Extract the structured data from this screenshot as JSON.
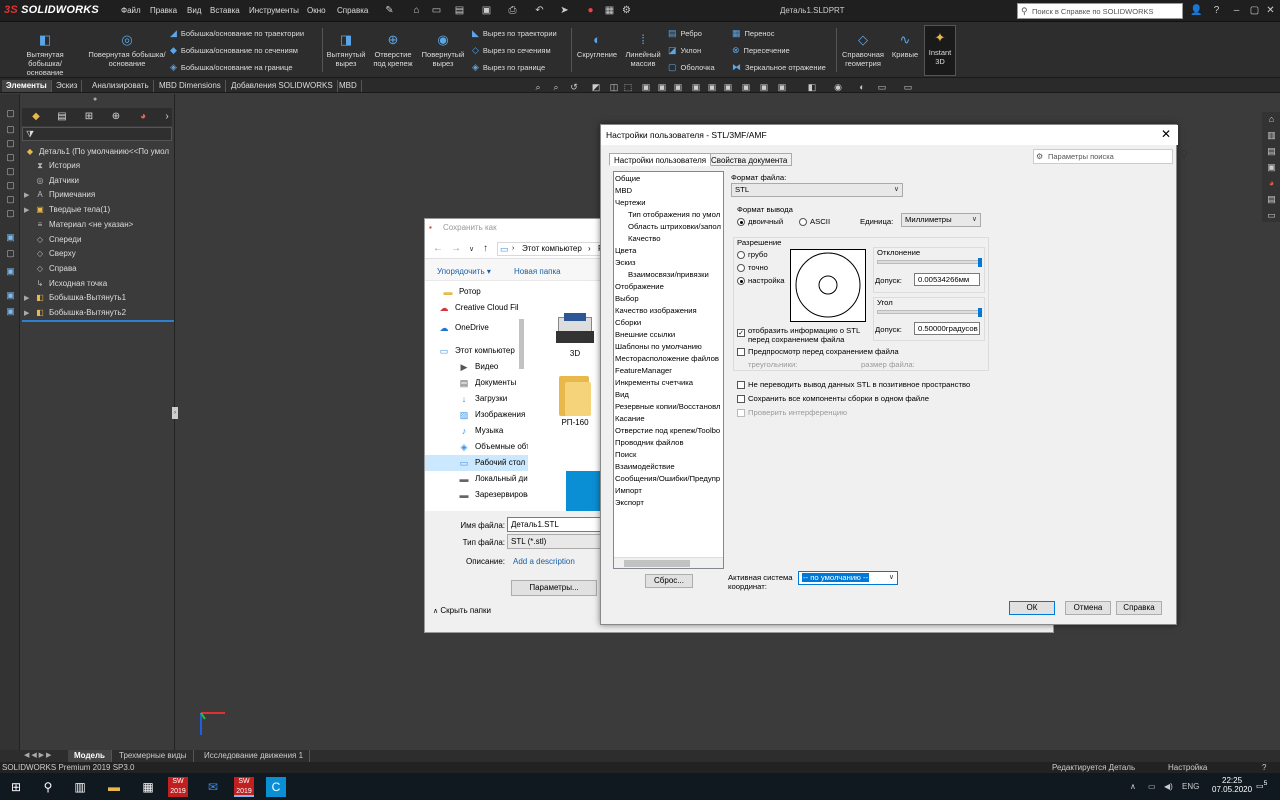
{
  "app": {
    "logo_ds": "3S",
    "logo_text": "SOLIDWORKS",
    "menu": [
      "Файл",
      "Правка",
      "Вид",
      "Вставка",
      "Инструменты",
      "Окно",
      "Справка"
    ],
    "doc_title": "Деталь1.SLDPRT",
    "search_placeholder": "Поиск в Справке по SOLIDWORKS"
  },
  "ribbon": {
    "big": [
      {
        "label": "Вытянутая бобышка/основание",
        "icon": "extrude-boss-icon"
      },
      {
        "label": "Повернутая бобышка/основание",
        "icon": "revolve-boss-icon"
      }
    ],
    "boss_rows": [
      "Бобышка/основание по траектории",
      "Бобышка/основание по сечениям",
      "Бобышка/основание на границе"
    ],
    "cut_big": [
      {
        "label": "Вытянутый вырез",
        "icon": "extrude-cut-icon"
      },
      {
        "label": "Отверстие под крепеж",
        "icon": "hole-wizard-icon"
      },
      {
        "label": "Повернутый вырез",
        "icon": "revolve-cut-icon"
      }
    ],
    "cut_rows": [
      "Вырез по траектории",
      "Вырез по сечениям",
      "Вырез по границе"
    ],
    "feat_big": [
      {
        "label": "Скругление",
        "icon": "fillet-icon"
      },
      {
        "label": "Линейный массив",
        "icon": "linear-pattern-icon"
      }
    ],
    "feat_rows": [
      "Ребро",
      "Уклон",
      "Оболочка"
    ],
    "feat_rows2": [
      "Перенос",
      "Пересечение",
      "Зеркальное отражение"
    ],
    "ref_big": [
      {
        "label": "Справочная геометрия",
        "icon": "ref-geometry-icon"
      },
      {
        "label": "Кривые",
        "icon": "curves-icon"
      },
      {
        "label": "Instant 3D",
        "icon": "instant3d-icon"
      }
    ]
  },
  "tabs": [
    "Элементы",
    "Эскиз",
    "Анализировать",
    "MBD Dimensions",
    "Добавления SOLIDWORKS",
    "MBD"
  ],
  "tree": {
    "root": "Деталь1  (По умолчанию<<По умол",
    "items": [
      {
        "label": "История",
        "icon": "history-icon",
        "expand": ""
      },
      {
        "label": "Датчики",
        "icon": "sensor-icon",
        "expand": ""
      },
      {
        "label": "Примечания",
        "icon": "annotations-icon",
        "expand": "▶"
      },
      {
        "label": "Твердые тела(1)",
        "icon": "solid-bodies-icon",
        "expand": "▶"
      },
      {
        "label": "Материал <не указан>",
        "icon": "material-icon",
        "expand": ""
      },
      {
        "label": "Спереди",
        "icon": "plane-icon",
        "expand": ""
      },
      {
        "label": "Сверху",
        "icon": "plane-icon",
        "expand": ""
      },
      {
        "label": "Справа",
        "icon": "plane-icon",
        "expand": ""
      },
      {
        "label": "Исходная точка",
        "icon": "origin-icon",
        "expand": ""
      },
      {
        "label": "Бобышка-Вытянуть1",
        "icon": "extrude-icon",
        "expand": "▶"
      },
      {
        "label": "Бобышка-Вытянуть2",
        "icon": "extrude-icon",
        "expand": "▶"
      }
    ]
  },
  "save_dialog": {
    "title": "Сохранить как",
    "address": "Этот компьютер",
    "address_suffix": "Р",
    "organize": "Упорядочить ▾",
    "new_folder": "Новая папка",
    "side": [
      {
        "label": "Ротор",
        "icon": "folder-icon"
      },
      {
        "label": "Creative Cloud Fil",
        "icon": "cloud-icon"
      },
      {
        "label": "OneDrive",
        "icon": "onedrive-icon"
      },
      {
        "label": "Этот компьютер",
        "icon": "computer-icon"
      },
      {
        "label": "Видео",
        "icon": "video-icon"
      },
      {
        "label": "Документы",
        "icon": "documents-icon"
      },
      {
        "label": "Загрузки",
        "icon": "downloads-icon"
      },
      {
        "label": "Изображения",
        "icon": "images-icon"
      },
      {
        "label": "Музыка",
        "icon": "music-icon"
      },
      {
        "label": "Объемные объе",
        "icon": "3d-objects-icon"
      },
      {
        "label": "Рабочий стол",
        "icon": "desktop-icon"
      },
      {
        "label": "Локальный дис",
        "icon": "disk-icon"
      },
      {
        "label": "Зарезервирован",
        "icon": "disk-icon"
      }
    ],
    "files": [
      {
        "label": "3D",
        "icon": "printer-icon"
      },
      {
        "label": "РП-160",
        "icon": "folder-icon"
      }
    ],
    "filename_label": "Имя файла:",
    "filename": "Деталь1.STL",
    "filetype_label": "Тип файла:",
    "filetype": "STL (*.stl)",
    "desc_label": "Описание:",
    "desc_link": "Add a description",
    "params_btn": "Параметры...",
    "hide_folders": "Скрыть папки"
  },
  "settings": {
    "title": "Настройки пользователя - STL/3MF/AMF",
    "tab_user": "Настройки пользователя",
    "tab_doc": "Свойства документа",
    "search": "Параметры поиска",
    "list": [
      {
        "label": "Общие",
        "sub": false
      },
      {
        "label": "MBD",
        "sub": false
      },
      {
        "label": "Чертежи",
        "sub": false
      },
      {
        "label": "Тип отображения по умол",
        "sub": true
      },
      {
        "label": "Область штриховки/запол",
        "sub": true
      },
      {
        "label": "Качество",
        "sub": true
      },
      {
        "label": "Цвета",
        "sub": false
      },
      {
        "label": "Эскиз",
        "sub": false
      },
      {
        "label": "Взаимосвязи/привязки",
        "sub": true
      },
      {
        "label": "Отображение",
        "sub": false
      },
      {
        "label": "Выбор",
        "sub": false
      },
      {
        "label": "Качество изображения",
        "sub": false
      },
      {
        "label": "Сборки",
        "sub": false
      },
      {
        "label": "Внешние ссылки",
        "sub": false
      },
      {
        "label": "Шаблоны по умолчанию",
        "sub": false
      },
      {
        "label": "Месторасположение файлов",
        "sub": false
      },
      {
        "label": "FeatureManager",
        "sub": false
      },
      {
        "label": "Инкременты счетчика",
        "sub": false
      },
      {
        "label": "Вид",
        "sub": false
      },
      {
        "label": "Резервные копии/Восстановл",
        "sub": false
      },
      {
        "label": "Касание",
        "sub": false
      },
      {
        "label": "Отверстие под крепеж/Toolbo",
        "sub": false
      },
      {
        "label": "Проводник файлов",
        "sub": false
      },
      {
        "label": "Поиск",
        "sub": false
      },
      {
        "label": "Взаимодействие",
        "sub": false
      },
      {
        "label": "Сообщения/Ошибки/Предупр",
        "sub": false
      },
      {
        "label": "Импорт",
        "sub": false
      },
      {
        "label": "Экспорт",
        "sub": false
      }
    ],
    "reset_btn": "Сброс...",
    "file_format_label": "Формат файла:",
    "file_format": "STL",
    "output_format_label": "Формат вывода",
    "binary": "двоичный",
    "ascii": "ASCII",
    "units_label": "Единица:",
    "units": "Миллиметры",
    "resolution_label": "Разрешение",
    "coarse": "грубо",
    "fine": "точно",
    "custom": "настройка",
    "deviation_label": "Отклонение",
    "tolerance_label": "Допуск:",
    "deviation_value": "0.00534266мм",
    "angle_label": "Угол",
    "angle_value": "0.50000градусов",
    "show_info": "отобразить информацию о STL перед сохранением файла",
    "preview": "Предпросмотр перед сохранением файла",
    "triangles": "треугольники:",
    "file_size": "размер файла:",
    "no_translate": "Не переводить вывод данных STL в позитивное пространство",
    "save_all": "Сохранить все компоненты сборки в одном файле",
    "check_interf": "Проверить интерференцию",
    "coord_label": "Активная система координат:",
    "coord_value": "-- по умолчанию --",
    "ok": "ОК",
    "cancel": "Отмена",
    "help": "Справка"
  },
  "bottom_tabs": [
    "Модель",
    "Трехмерные виды",
    "Исследование движения 1"
  ],
  "status": {
    "left": "SOLIDWORKS Premium 2019 SP3.0",
    "editing": "Редактируется Деталь",
    "custom": "Настройка"
  },
  "taskbar": {
    "time": "22:25",
    "date": "07.05.2020",
    "notif": "5",
    "sw_year": "2019"
  }
}
